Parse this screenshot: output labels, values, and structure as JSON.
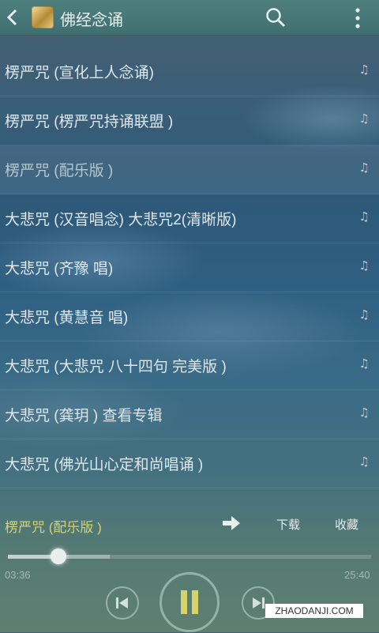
{
  "topbar": {
    "title": "佛经念诵",
    "icons": {
      "back": "back-arrow-icon",
      "logo": "app-logo",
      "search": "search-icon",
      "more": "more-vertical-icon"
    }
  },
  "songs": [
    {
      "title": "楞严咒 (宣化上人念诵)",
      "icon": "music-note-icon"
    },
    {
      "title": "楞严咒 (楞严咒持诵联盟 )",
      "icon": "music-note-icon"
    },
    {
      "title": "楞严咒 (配乐版 )",
      "icon": "music-note-icon",
      "active": true
    },
    {
      "title": "大悲咒 (汉音唱念) 大悲咒2(清晰版)",
      "icon": "music-note-icon"
    },
    {
      "title": "大悲咒 (齐豫 唱)",
      "icon": "music-note-icon"
    },
    {
      "title": "大悲咒 (黄慧音 唱)",
      "icon": "music-note-icon"
    },
    {
      "title": "大悲咒 (大悲咒 八十四句 完美版 )",
      "icon": "music-note-icon"
    },
    {
      "title": "大悲咒 (龚玥 ) 查看专辑",
      "icon": "music-note-icon"
    },
    {
      "title": "大悲咒 (佛光山心定和尚唱诵 )",
      "icon": "music-note-icon"
    }
  ],
  "note_glyph": "♫",
  "player": {
    "now_playing": "楞严咒 (配乐版 )",
    "download_label": "下载",
    "favorite_label": "收藏",
    "elapsed": "03:36",
    "total": "25:40",
    "progress": 0.14,
    "buffered": 0.28,
    "state": "playing",
    "icons": {
      "share": "share-arrow-icon",
      "prev": "previous-icon",
      "pause": "pause-icon",
      "next": "next-icon"
    }
  },
  "watermark": "ZHAODANJI.COM",
  "colors": {
    "accent": "#d8d26a",
    "topbar": "#4a7a78"
  }
}
